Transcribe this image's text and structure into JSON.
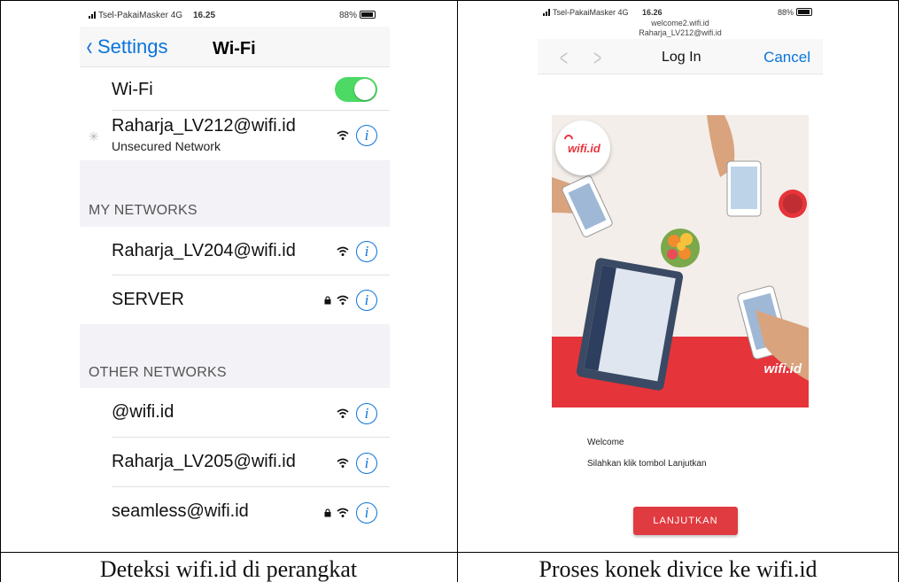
{
  "left_phone": {
    "status": {
      "carrier": "Tsel-PakaiMasker  4G",
      "time": "16.25",
      "battery": "88%"
    },
    "nav": {
      "back_label": "Settings",
      "title": "Wi-Fi"
    },
    "wifi_row": {
      "label": "Wi-Fi",
      "toggle_on": true
    },
    "connecting": {
      "network": "Raharja_LV212@wifi.id",
      "status": "Unsecured Network"
    },
    "my_networks": {
      "header": "MY NETWORKS",
      "items": [
        {
          "name": "Raharja_LV204@wifi.id",
          "locked": false
        },
        {
          "name": "SERVER",
          "locked": true
        }
      ]
    },
    "other_networks": {
      "header": "OTHER NETWORKS",
      "items": [
        {
          "name": "@wifi.id",
          "locked": false
        },
        {
          "name": "Raharja_LV205@wifi.id",
          "locked": false
        },
        {
          "name": "seamless@wifi.id",
          "locked": true
        }
      ]
    },
    "info_glyph": "i"
  },
  "right_phone": {
    "status": {
      "carrier": "Tsel-PakaiMasker  4G",
      "time": "16.26",
      "battery": "88%"
    },
    "url": {
      "host": "welcome2.wifi.id",
      "ssid": "Raharja_LV212@wifi.id"
    },
    "nav": {
      "back_glyph": "<",
      "forward_glyph": ">",
      "title": "Log In",
      "cancel_label": "Cancel"
    },
    "logo_text": "wifi.id",
    "welcome": "Welcome",
    "instruction": "Silahkan klik tombol Lanjutkan",
    "button_label": "LANJUTKAN"
  },
  "captions": {
    "left": "Deteksi wifi.id di perangkat",
    "right": "Proses konek divice ke wifi.id"
  },
  "colors": {
    "ios_blue": "#0a74da",
    "toggle_green": "#4cd964",
    "brand_red": "#e6343b"
  }
}
